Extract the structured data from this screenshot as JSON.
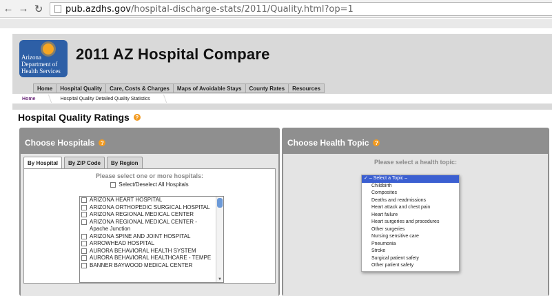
{
  "browser": {
    "url_host": "pub.azdhs.gov",
    "url_path": "/hospital-discharge-stats/2011/Quality.html?op=1",
    "back_icon": "back-arrow-icon",
    "forward_icon": "forward-arrow-icon",
    "reload_icon": "reload-icon",
    "home_icon": "home-icon"
  },
  "logo": {
    "line1": "Arizona",
    "line2": "Department of",
    "line3": "Health Services"
  },
  "site_title": "2011 AZ Hospital Compare",
  "nav": [
    "Home",
    "Hospital Quality",
    "Care, Costs & Charges",
    "Maps of Avoidable Stays",
    "County Rates",
    "Resources"
  ],
  "breadcrumb": [
    "Home",
    "Hospital Quality Detailed Quality Statistics"
  ],
  "page_heading": "Hospital Quality Ratings",
  "hospitals_panel": {
    "title": "Choose Hospitals",
    "tabs": [
      "By Hospital",
      "By ZIP Code",
      "By Region"
    ],
    "prompt": "Please select one or more hospitals:",
    "select_all": "Select/Deselect All Hospitals",
    "hospitals": [
      "ARIZONA HEART HOSPITAL",
      "ARIZONA ORTHOPEDIC SURGICAL HOSPITAL",
      "ARIZONA REGIONAL MEDICAL CENTER",
      "ARIZONA REGIONAL MEDICAL CENTER - Apache Junction",
      "ARIZONA SPINE AND JOINT HOSPITAL",
      "ARROWHEAD HOSPITAL",
      "AURORA BEHAVIORAL HEALTH SYSTEM",
      "AURORA BEHAVIORAL HEALTHCARE - TEMPE",
      "BANNER BAYWOOD MEDICAL CENTER"
    ]
  },
  "topic_panel": {
    "title": "Choose Health Topic",
    "prompt": "Please select a health topic:",
    "selected_marker": "✓",
    "options": [
      "– Select a Topic –",
      "Childbirth",
      "Composites",
      "Deaths and readmissions",
      "Heart attack and chest pain",
      "Heart failure",
      "Heart surgeries and procedures",
      "Other surgeries",
      "Nursing sensitive care",
      "Pneumonia",
      "Stroke",
      "Surgical patient safety",
      "Other patient safety"
    ]
  },
  "colors": {
    "panel": "#8f8f8f",
    "logo": "#2d5fa6",
    "help": "#f29a1f",
    "selected_option": "#3b5fd1"
  }
}
